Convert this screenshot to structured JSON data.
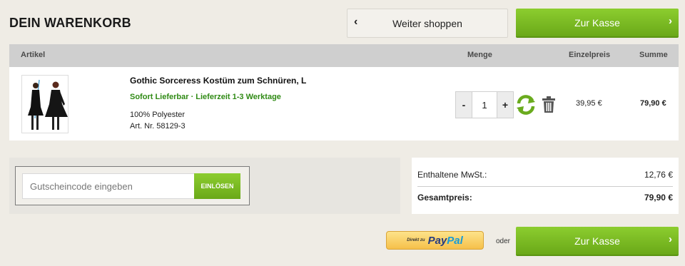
{
  "header": {
    "title": "DEIN WARENKORB",
    "continue_label": "Weiter shoppen",
    "checkout_label": "Zur Kasse"
  },
  "table": {
    "col_article": "Artikel",
    "col_qty": "Menge",
    "col_unit": "Einzelpreis",
    "col_sum": "Summe"
  },
  "item": {
    "name": "Gothic Sorceress Kostüm zum Schnüren, L",
    "availability": "Sofort Lieferbar · Lieferzeit 1-3 Werktage",
    "material": "100% Polyester",
    "article_no": "Art. Nr. 58129-3",
    "qty_minus": "-",
    "qty_value": "1",
    "qty_plus": "+",
    "unit_price": "39,95 €",
    "total": "79,90 €"
  },
  "coupon": {
    "placeholder": "Gutscheincode eingeben",
    "redeem_label": "EINLÖSEN"
  },
  "totals": {
    "vat_label": "Enthaltene MwSt.:",
    "vat_value": "12,76 €",
    "total_label": "Gesamtpreis:",
    "total_value": "79,90 €"
  },
  "footer": {
    "paypal_prefix": "Direkt zu",
    "paypal_pay": "Pay",
    "paypal_pal": "Pal",
    "or_label": "oder",
    "checkout_label": "Zur Kasse"
  },
  "colors": {
    "accent_green": "#7aba22",
    "availability_green": "#2f8a14",
    "paypal_yellow": "#f6c04a"
  }
}
